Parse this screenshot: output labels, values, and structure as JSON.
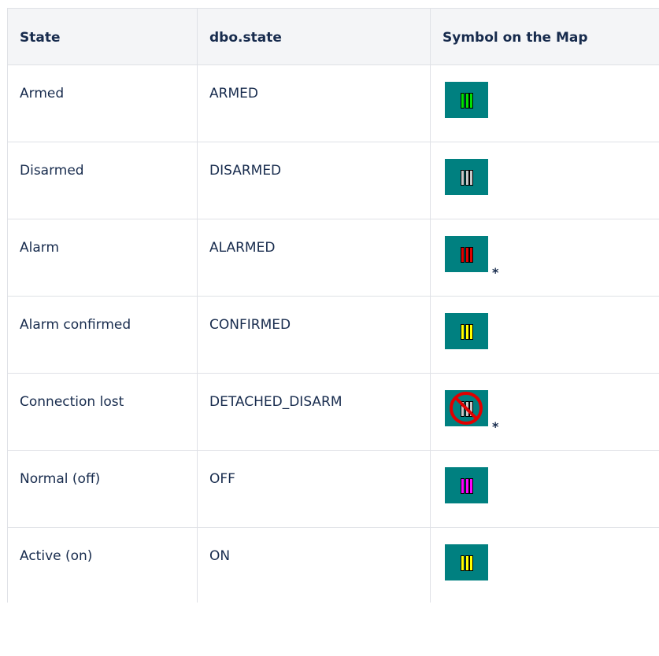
{
  "table": {
    "headers": [
      "State",
      "dbo.state",
      "Symbol on the Map"
    ],
    "rows": [
      {
        "state": "Armed",
        "dbo_state": "ARMED",
        "symbol": {
          "icon": "armed-symbol-icon",
          "bar_color": "#00e000",
          "crossed": false,
          "asterisk": ""
        }
      },
      {
        "state": "Disarmed",
        "dbo_state": "DISARMED",
        "symbol": {
          "icon": "disarmed-symbol-icon",
          "bar_color": "#c8c8c8",
          "crossed": false,
          "asterisk": ""
        }
      },
      {
        "state": "Alarm",
        "dbo_state": "ALARMED",
        "symbol": {
          "icon": "alarm-symbol-icon",
          "bar_color": "#e00000",
          "crossed": false,
          "asterisk": "*"
        }
      },
      {
        "state": "Alarm confirmed",
        "dbo_state": "CONFIRMED",
        "symbol": {
          "icon": "alarm-confirmed-symbol-icon",
          "bar_color": "#ffff00",
          "crossed": false,
          "asterisk": ""
        }
      },
      {
        "state": "Connection lost",
        "dbo_state": "DETACHED_DISARM",
        "symbol": {
          "icon": "connection-lost-symbol-icon",
          "bar_color": "#c8c8c8",
          "crossed": true,
          "asterisk": "*"
        }
      },
      {
        "state": "Normal (off)",
        "dbo_state": "OFF",
        "symbol": {
          "icon": "normal-off-symbol-icon",
          "bar_color": "#ff00ff",
          "crossed": false,
          "asterisk": ""
        }
      },
      {
        "state": "Active (on)",
        "dbo_state": "ON",
        "symbol": {
          "icon": "active-on-symbol-icon",
          "bar_color": "#ffff00",
          "crossed": false,
          "asterisk": ""
        }
      }
    ]
  },
  "colors": {
    "symbol_background": "#008080",
    "header_background": "#f4f5f7",
    "border": "#dfe1e6",
    "text": "#172b4d",
    "no_sign": "#e00000"
  }
}
